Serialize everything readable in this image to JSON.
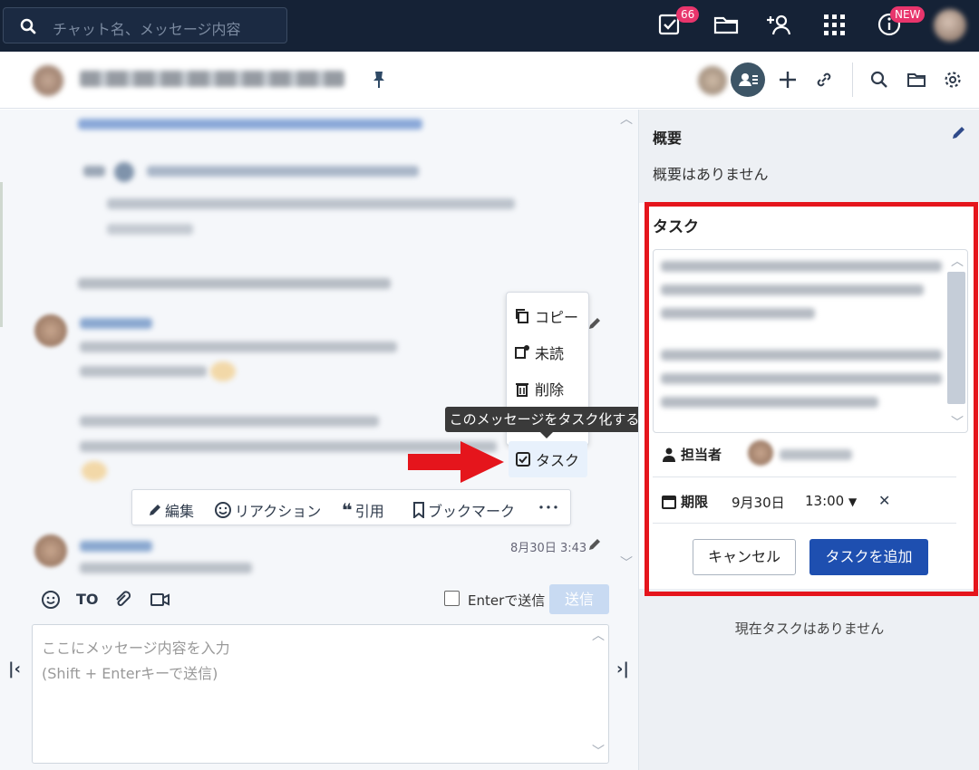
{
  "topbar": {
    "search_placeholder": "チャット名、メッセージ内容",
    "task_badge": "66",
    "new_badge": "NEW"
  },
  "context_menu": {
    "copy": "コピー",
    "unread": "未読",
    "delete": "削除",
    "task": "タスク",
    "tooltip": "このメッセージをタスク化する"
  },
  "action_bar": {
    "edit": "編集",
    "reaction": "リアクション",
    "quote": "引用",
    "bookmark": "ブックマーク",
    "more": "･･･"
  },
  "message": {
    "timestamp": "8月30日 3:43"
  },
  "composer": {
    "to_label": "TO",
    "enter_send_label": "Enterで送信",
    "send_button": "送信",
    "placeholder": "ここにメッセージ内容を入力\n(Shift + Enterキーで送信)"
  },
  "right_panel": {
    "summary_title": "概要",
    "summary_text": "概要はありません",
    "task_title": "タスク",
    "assignee_label": "担当者",
    "due_label": "期限",
    "due_date": "9月30日",
    "due_time": "13:00",
    "cancel_button": "キャンセル",
    "add_task_button": "タスクを追加",
    "no_tasks": "現在タスクはありません"
  },
  "colors": {
    "topbar_bg": "#152236",
    "primary_button": "#1e4fb0",
    "highlight_red": "#e5151c",
    "badge": "#e8356c"
  }
}
